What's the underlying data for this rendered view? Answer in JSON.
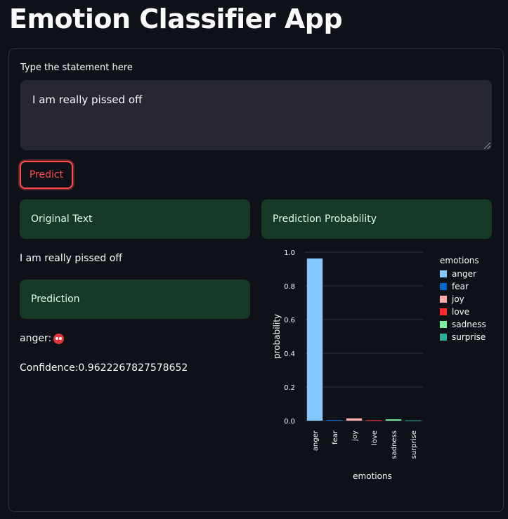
{
  "app": {
    "title": "Emotion Classifier App"
  },
  "form": {
    "input_label": "Type the statement here",
    "input_value": "I am really pissed off",
    "predict_button": "Predict"
  },
  "results": {
    "original_text_header": "Original Text",
    "original_text": "I am really pissed off",
    "prediction_header": "Prediction",
    "prediction_label": "anger:",
    "prediction_icon": "angry-face-icon",
    "confidence_text": "Confidence:0.9622267827578652",
    "probability_header": "Prediction Probability"
  },
  "colors": {
    "accent": "#ff4b4b",
    "success_bg": "#173928",
    "success_text": "#dffde9"
  },
  "chart_data": {
    "type": "bar",
    "categories": [
      "anger",
      "fear",
      "joy",
      "love",
      "sadness",
      "surprise"
    ],
    "values": [
      0.962,
      0.004,
      0.014,
      0.003,
      0.008,
      0.002
    ],
    "colors": [
      "#83c9ff",
      "#0068c9",
      "#ffabab",
      "#ff2b2b",
      "#7defa1",
      "#29b09d"
    ],
    "xlabel": "emotions",
    "ylabel": "probability",
    "ylim": [
      0,
      1.0
    ],
    "yticks": [
      "0.0",
      "0.2",
      "0.4",
      "0.6",
      "0.8",
      "1.0"
    ],
    "legend_title": "emotions",
    "legend_position": "right",
    "grid": true
  }
}
